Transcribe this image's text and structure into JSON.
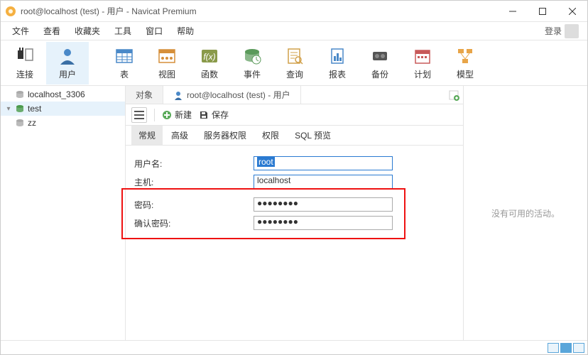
{
  "title": "root@localhost (test) - 用户 - Navicat Premium",
  "menu": [
    "文件",
    "查看",
    "收藏夹",
    "工具",
    "窗口",
    "帮助"
  ],
  "login": "登录",
  "toolbar": [
    {
      "label": "连接",
      "icon": "plug"
    },
    {
      "label": "用户",
      "icon": "user",
      "active": true
    },
    {
      "label": "表",
      "icon": "table"
    },
    {
      "label": "视图",
      "icon": "view"
    },
    {
      "label": "函数",
      "icon": "fx"
    },
    {
      "label": "事件",
      "icon": "event"
    },
    {
      "label": "查询",
      "icon": "query"
    },
    {
      "label": "报表",
      "icon": "report"
    },
    {
      "label": "备份",
      "icon": "backup"
    },
    {
      "label": "计划",
      "icon": "schedule"
    },
    {
      "label": "模型",
      "icon": "model"
    }
  ],
  "sidebar": [
    {
      "label": "localhost_3306",
      "expanded": false
    },
    {
      "label": "test",
      "expanded": true,
      "active": true
    },
    {
      "label": "zz",
      "expanded": false
    }
  ],
  "tabs": {
    "object": "对象",
    "activeLabel": "root@localhost (test) - 用户"
  },
  "actions": {
    "new": "新建",
    "save": "保存"
  },
  "subtabs": [
    "常规",
    "高级",
    "服务器权限",
    "权限",
    "SQL 预览"
  ],
  "form": {
    "userLabel": "用户名:",
    "userValue": "root",
    "hostLabel": "主机:",
    "hostValue": "localhost",
    "pwdLabel": "密码:",
    "pwdValue": "●●●●●●●●",
    "pwd2Label": "确认密码:",
    "pwd2Value": "●●●●●●●●"
  },
  "rightPanel": "没有可用的活动。"
}
